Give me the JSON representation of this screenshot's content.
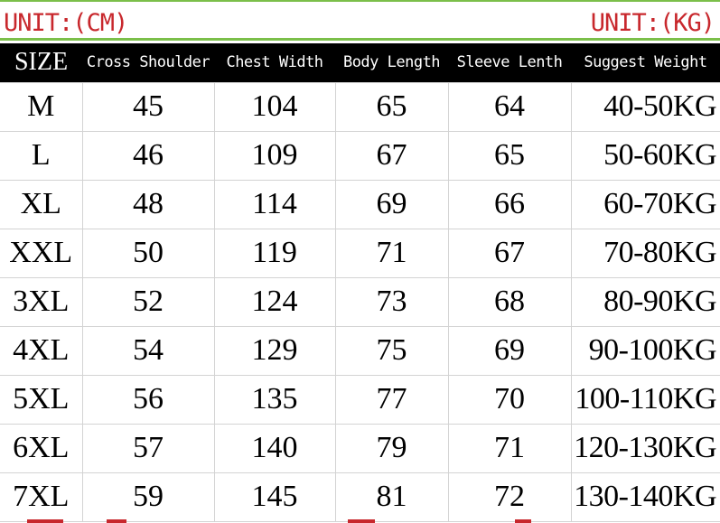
{
  "units": {
    "left": "UNIT:(CM)",
    "right": "UNIT:(KG)"
  },
  "table": {
    "headers": [
      "SIZE",
      "Cross Shoulder",
      "Chest Width",
      "Body Length",
      "Sleeve Lenth",
      "Suggest Weight"
    ],
    "rows": [
      [
        "M",
        "45",
        "104",
        "65",
        "64",
        "40-50KG"
      ],
      [
        "L",
        "46",
        "109",
        "67",
        "65",
        "50-60KG"
      ],
      [
        "XL",
        "48",
        "114",
        "69",
        "66",
        "60-70KG"
      ],
      [
        "XXL",
        "50",
        "119",
        "71",
        "67",
        "70-80KG"
      ],
      [
        "3XL",
        "52",
        "124",
        "73",
        "68",
        "80-90KG"
      ],
      [
        "4XL",
        "54",
        "129",
        "75",
        "69",
        "90-100KG"
      ],
      [
        "5XL",
        "56",
        "135",
        "77",
        "70",
        "100-110KG"
      ],
      [
        "6XL",
        "57",
        "140",
        "79",
        "71",
        "120-130KG"
      ],
      [
        "7XL",
        "59",
        "145",
        "81",
        "72",
        "130-140KG"
      ]
    ]
  },
  "colors": {
    "unit_text": "#c8282d",
    "accent_line": "#7bbf4a",
    "header_bg": "#000000",
    "header_text": "#ffffff",
    "grid": "#d3d3d3"
  }
}
